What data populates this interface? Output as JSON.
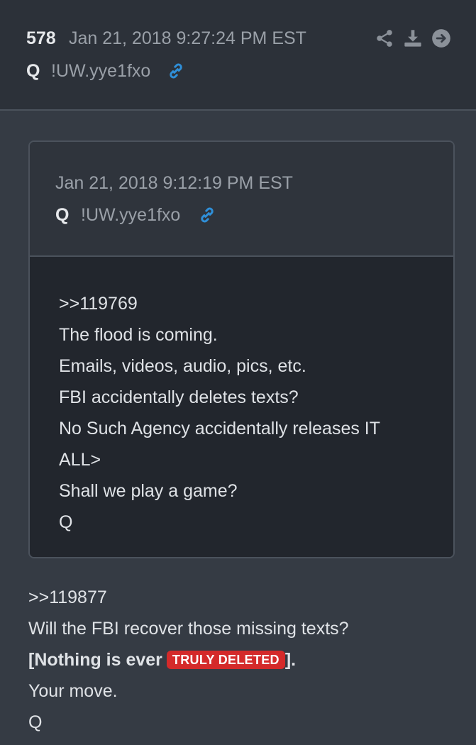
{
  "post": {
    "number": "578",
    "date": "Jan 21, 2018 9:27:24 PM EST",
    "author": "Q",
    "trip": "!UW.yye1fxo",
    "icons": [
      "link-icon",
      "share-icon",
      "download-icon",
      "arrow-right-circle-icon"
    ]
  },
  "quote": {
    "date": "Jan 21, 2018 9:12:19 PM EST",
    "author": "Q",
    "trip": "!UW.yye1fxo",
    "lines": [
      ">>119769",
      "The flood is coming.",
      "Emails, videos, audio, pics, etc.",
      "FBI accidentally deletes texts?",
      "No Such Agency accidentally releases IT",
      "ALL>",
      "Shall we play a game?",
      "Q"
    ]
  },
  "reply": {
    "ref": ">>119877",
    "line1": "Will the FBI recover those missing texts?",
    "line2_prefix": "[Nothing is ever",
    "badge": "TRULY DELETED",
    "line2_suffix": "].",
    "line3": "Your move.",
    "line4": "Q"
  },
  "colors": {
    "link_icon": "#2f8fd8",
    "badge": "#d42a2a"
  }
}
